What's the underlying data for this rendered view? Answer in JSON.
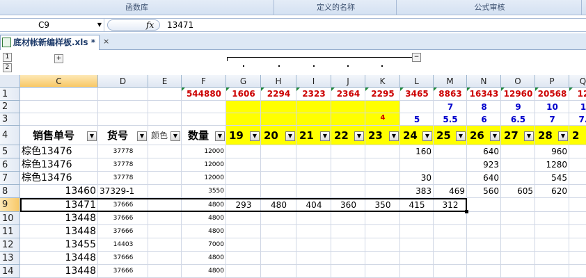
{
  "ribbon": {
    "groups": [
      "函数库",
      "定义的名称",
      "公式审核"
    ]
  },
  "formula_bar": {
    "name_box": "C9",
    "fx": "fx",
    "value": "13471"
  },
  "sheet_tab": {
    "label": "底材帐新编样板.xls *"
  },
  "outline": {
    "level1": "1",
    "level2": "2",
    "expand": "+",
    "collapse": "−"
  },
  "columns": [
    "C",
    "D",
    "E",
    "F",
    "G",
    "H",
    "I",
    "J",
    "K",
    "L",
    "M",
    "N",
    "O",
    "P",
    "Q"
  ],
  "rows": [
    "1",
    "2",
    "3",
    "4",
    "5",
    "6",
    "7",
    "8",
    "9",
    "10",
    "11",
    "12",
    "13",
    "14"
  ],
  "row1_totals": {
    "F": "544880",
    "G": "1606",
    "H": "2294",
    "I": "2323",
    "J": "2364",
    "K": "2295",
    "L": "3465",
    "M": "8863",
    "N": "16343",
    "O": "12960",
    "P": "20568",
    "Q": "12"
  },
  "row2": {
    "M": "7",
    "N": "8",
    "O": "9",
    "P": "10",
    "Q": "1"
  },
  "row3": {
    "K": "4",
    "L": "5",
    "M": "5.5",
    "N": "6",
    "O": "6.5",
    "P": "7",
    "Q": "7."
  },
  "header_row": {
    "C": "销售单号",
    "D": "货号",
    "E": "颜色",
    "F": "数量",
    "G": "19",
    "H": "20",
    "I": "21",
    "J": "22",
    "K": "23",
    "L": "24",
    "M": "25",
    "N": "26",
    "O": "27",
    "P": "28",
    "Q": "2"
  },
  "data_rows": [
    {
      "C": "棕色13476",
      "D": "37778",
      "F": "12000",
      "L": "160",
      "N": "640",
      "P": "960"
    },
    {
      "C": "棕色13476",
      "D": "37778",
      "F": "12000",
      "N": "923",
      "P": "1280"
    },
    {
      "C": "棕色13476",
      "D": "37778",
      "F": "12000",
      "L": "30",
      "N": "640",
      "P": "545"
    },
    {
      "C": "13460",
      "D": "37329-1",
      "F": "3550",
      "L": "383",
      "M": "469",
      "N": "560",
      "O": "605",
      "P": "620"
    },
    {
      "C": "13471",
      "D": "37666",
      "F": "4800",
      "G": "293",
      "H": "480",
      "I": "404",
      "J": "360",
      "K": "350",
      "L": "415",
      "M": "312"
    },
    {
      "C": "13448",
      "D": "37666",
      "F": "4800"
    },
    {
      "C": "13448",
      "D": "37666",
      "F": "4800"
    },
    {
      "C": "13455",
      "D": "14403",
      "F": "7000"
    },
    {
      "C": "13448",
      "D": "37666",
      "F": "4800"
    },
    {
      "C": "13448",
      "D": "37666",
      "F": "4800"
    }
  ],
  "colors": {
    "yellow_fill": "#ffff00",
    "red_total": "#cc0000",
    "blue_size": "#0000cc",
    "selection": "#f8c866"
  },
  "icons": {
    "dropdown": "filter-dropdown-icon",
    "excel": "excel-file-icon"
  }
}
